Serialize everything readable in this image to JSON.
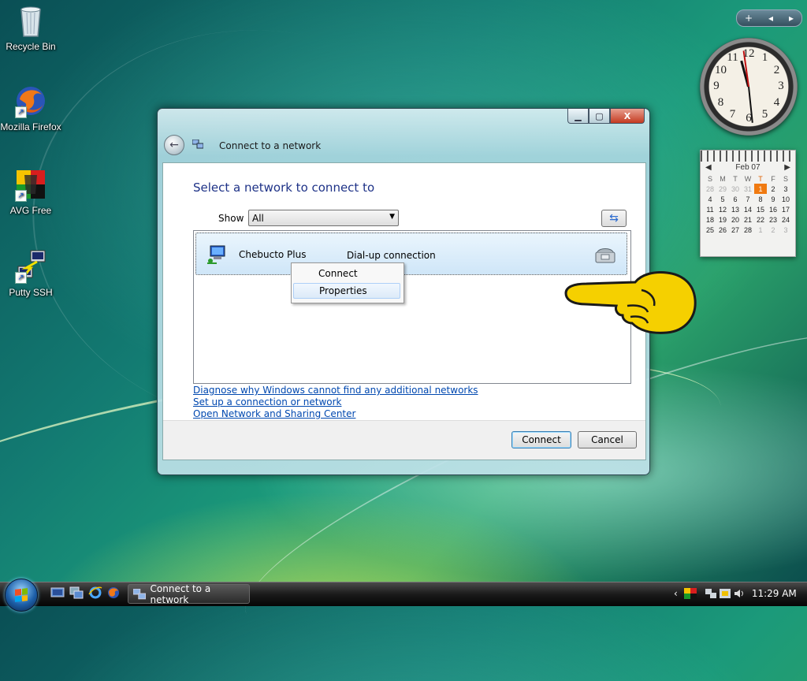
{
  "desktop": {
    "icons": [
      {
        "label": "Recycle Bin"
      },
      {
        "label": "Mozilla Firefox"
      },
      {
        "label": "AVG Free"
      },
      {
        "label": "Putty SSH"
      }
    ]
  },
  "calendar": {
    "month": "Feb 07",
    "weekdays": [
      "S",
      "M",
      "T",
      "W",
      "T",
      "F",
      "S"
    ],
    "weeks": [
      [
        "28",
        "29",
        "30",
        "31",
        "1",
        "2",
        "3"
      ],
      [
        "4",
        "5",
        "6",
        "7",
        "8",
        "9",
        "10"
      ],
      [
        "11",
        "12",
        "13",
        "14",
        "15",
        "16",
        "17"
      ],
      [
        "18",
        "19",
        "20",
        "21",
        "22",
        "23",
        "24"
      ],
      [
        "25",
        "26",
        "27",
        "28",
        "1",
        "2",
        "3"
      ]
    ],
    "today": "1"
  },
  "clock": {
    "numerals": [
      "12",
      "1",
      "2",
      "3",
      "4",
      "5",
      "6",
      "7",
      "8",
      "9",
      "10",
      "11"
    ],
    "time": "11:29"
  },
  "window": {
    "title": "Connect to a network",
    "close_label": "X",
    "heading": "Select a network to connect to",
    "show_label": "Show",
    "show_value": "All",
    "networks": [
      {
        "name": "Chebucto Plus",
        "type": "Dial-up connection"
      }
    ],
    "context_menu": [
      "Connect",
      "Properties"
    ],
    "links": [
      "Diagnose why Windows cannot find any additional networks",
      "Set up a connection or network",
      "Open Network and Sharing Center"
    ],
    "connect_button": "Connect",
    "cancel_button": "Cancel"
  },
  "taskbar": {
    "task_label": "Connect to a network",
    "time": "11:29 AM"
  },
  "colors": {
    "heading": "#1e3287",
    "link": "#0048b0",
    "hand_pointer": "#f5d000",
    "calendar_today": "#f07a10"
  }
}
